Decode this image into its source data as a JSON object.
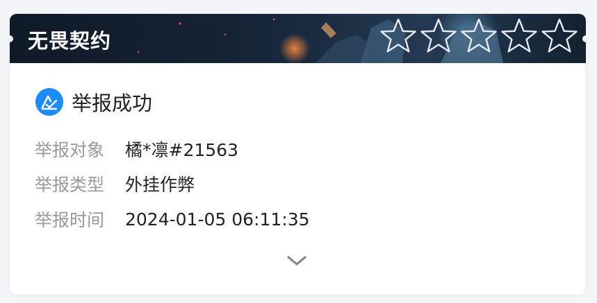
{
  "card": {
    "game_title": "无畏契约",
    "rating": {
      "max": 5,
      "filled": 0,
      "icon": "star-outline-icon"
    },
    "status": {
      "icon": "report-success-icon",
      "text": "举报成功",
      "icon_color": "#1a8cff"
    },
    "details": [
      {
        "label": "举报对象",
        "value": "橘*凛#21563"
      },
      {
        "label": "举报类型",
        "value": "外挂作弊"
      },
      {
        "label": "举报时间",
        "value": "2024-01-05 06:11:35"
      }
    ],
    "expand_icon": "chevron-down-icon"
  },
  "colors": {
    "banner_bg": "#152335",
    "label_text": "#9a9a9a",
    "value_text": "#222222",
    "accent": "#1a8cff"
  }
}
